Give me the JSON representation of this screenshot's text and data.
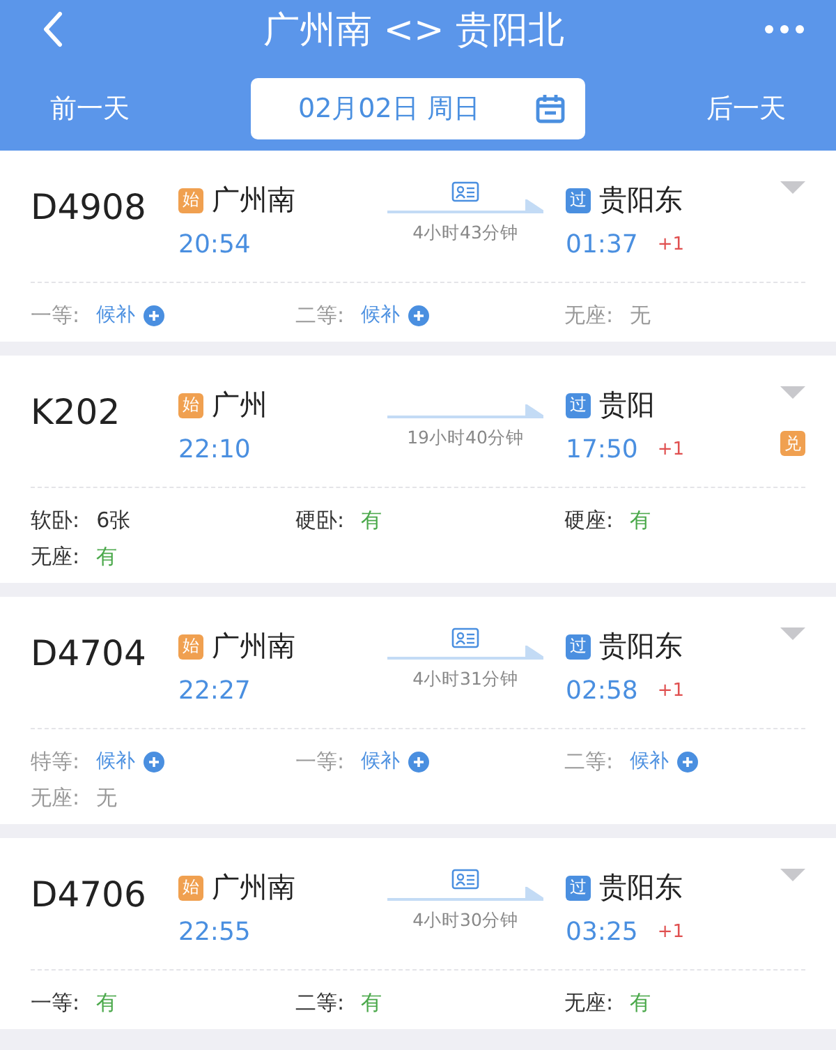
{
  "header": {
    "title": "广州南 <> 贵阳北",
    "prev_day": "前一天",
    "date": "02月02日 周日",
    "next_day": "后一天"
  },
  "trains": [
    {
      "number": "D4908",
      "from_badge": "始",
      "from": "广州南",
      "depart": "20:54",
      "id_card": true,
      "duration": "4小时43分钟",
      "to_badge": "过",
      "to": "贵阳东",
      "arrive": "01:37",
      "day_offset": "+1",
      "seats": [
        {
          "label": "一等:",
          "value": "候补",
          "kind": "waitlist"
        },
        {
          "label": "二等:",
          "value": "候补",
          "kind": "waitlist"
        },
        {
          "label": "无座:",
          "value": "无",
          "kind": "none"
        }
      ]
    },
    {
      "number": "K202",
      "from_badge": "始",
      "from": "广州",
      "depart": "22:10",
      "id_card": false,
      "duration": "19小时40分钟",
      "to_badge": "过",
      "to": "贵阳",
      "arrive": "17:50",
      "day_offset": "+1",
      "exchange_badge": "兑",
      "seats": [
        {
          "label": "软卧:",
          "value": "6张",
          "kind": "count"
        },
        {
          "label": "硬卧:",
          "value": "有",
          "kind": "available"
        },
        {
          "label": "硬座:",
          "value": "有",
          "kind": "available"
        },
        {
          "label": "无座:",
          "value": "有",
          "kind": "available"
        }
      ]
    },
    {
      "number": "D4704",
      "from_badge": "始",
      "from": "广州南",
      "depart": "22:27",
      "id_card": true,
      "duration": "4小时31分钟",
      "to_badge": "过",
      "to": "贵阳东",
      "arrive": "02:58",
      "day_offset": "+1",
      "seats": [
        {
          "label": "特等:",
          "value": "候补",
          "kind": "waitlist"
        },
        {
          "label": "一等:",
          "value": "候补",
          "kind": "waitlist"
        },
        {
          "label": "二等:",
          "value": "候补",
          "kind": "waitlist"
        },
        {
          "label": "无座:",
          "value": "无",
          "kind": "none"
        }
      ]
    },
    {
      "number": "D4706",
      "from_badge": "始",
      "from": "广州南",
      "depart": "22:55",
      "id_card": true,
      "duration": "4小时30分钟",
      "to_badge": "过",
      "to": "贵阳东",
      "arrive": "03:25",
      "day_offset": "+1",
      "seats": [
        {
          "label": "一等:",
          "value": "有",
          "kind": "available"
        },
        {
          "label": "二等:",
          "value": "有",
          "kind": "available"
        },
        {
          "label": "无座:",
          "value": "有",
          "kind": "available"
        }
      ]
    }
  ]
}
